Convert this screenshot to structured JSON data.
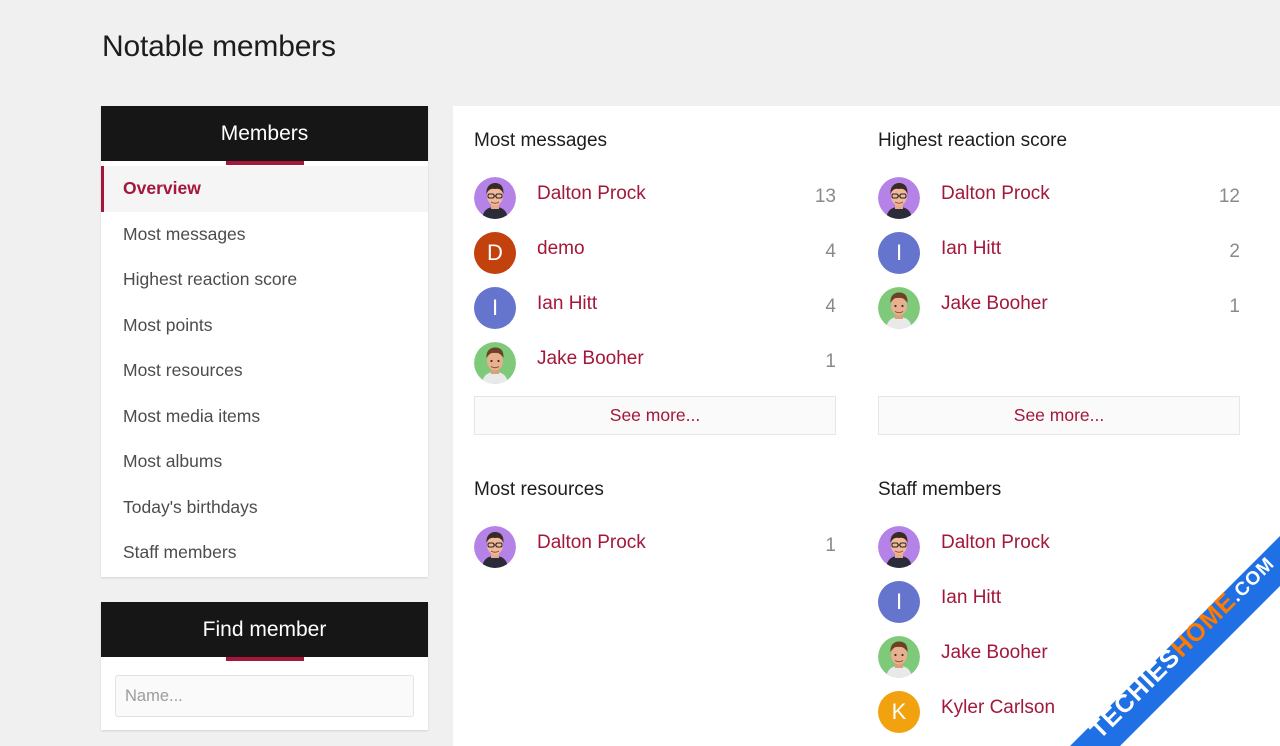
{
  "page": {
    "title": "Notable members"
  },
  "sidebar": {
    "header": "Members",
    "items": [
      {
        "label": "Overview",
        "active": true
      },
      {
        "label": "Most messages"
      },
      {
        "label": "Highest reaction score"
      },
      {
        "label": "Most points"
      },
      {
        "label": "Most resources"
      },
      {
        "label": "Most media items"
      },
      {
        "label": "Most albums"
      },
      {
        "label": "Today's birthdays"
      },
      {
        "label": "Staff members"
      }
    ]
  },
  "find_member": {
    "header": "Find member",
    "placeholder": "Name..."
  },
  "sections": {
    "most_messages": {
      "title": "Most messages",
      "members": [
        {
          "name": "Dalton Prock",
          "count": "13",
          "avatar": "dalton-avatar"
        },
        {
          "name": "demo",
          "count": "4",
          "avatar": "letter",
          "letter": "D"
        },
        {
          "name": "Ian Hitt",
          "count": "4",
          "avatar": "letter",
          "letter": "I"
        },
        {
          "name": "Jake Booher",
          "count": "1",
          "avatar": "jake-avatar"
        }
      ],
      "see_more": "See more..."
    },
    "highest_reaction": {
      "title": "Highest reaction score",
      "members": [
        {
          "name": "Dalton Prock",
          "count": "12"
        },
        {
          "name": "Ian Hitt",
          "count": "2",
          "letter": "I"
        },
        {
          "name": "Jake Booher",
          "count": "1"
        }
      ],
      "see_more": "See more..."
    },
    "most_resources": {
      "title": "Most resources",
      "members": [
        {
          "name": "Dalton Prock",
          "count": "1"
        }
      ]
    },
    "staff_members": {
      "title": "Staff members",
      "members": [
        {
          "name": "Dalton Prock"
        },
        {
          "name": "Ian Hitt",
          "letter": "I"
        },
        {
          "name": "Jake Booher"
        },
        {
          "name": "Kyler Carlson",
          "letter": "K"
        }
      ]
    }
  },
  "colors": {
    "accent": "#a3173a",
    "header_bg": "#161616",
    "avatar_demo": "#c2410c",
    "avatar_ian": "#6574cd",
    "avatar_kyler": "#f2a20e",
    "avatar_dalton_bg": "#b582e8",
    "avatar_jake_bg": "#7fc97a",
    "watermark_blue": "#1f6fe5",
    "watermark_orange": "#ff7a00"
  },
  "watermark": {
    "text_part1": "TECHIES",
    "text_part2": "HOME",
    "text_part3": ".COM"
  }
}
